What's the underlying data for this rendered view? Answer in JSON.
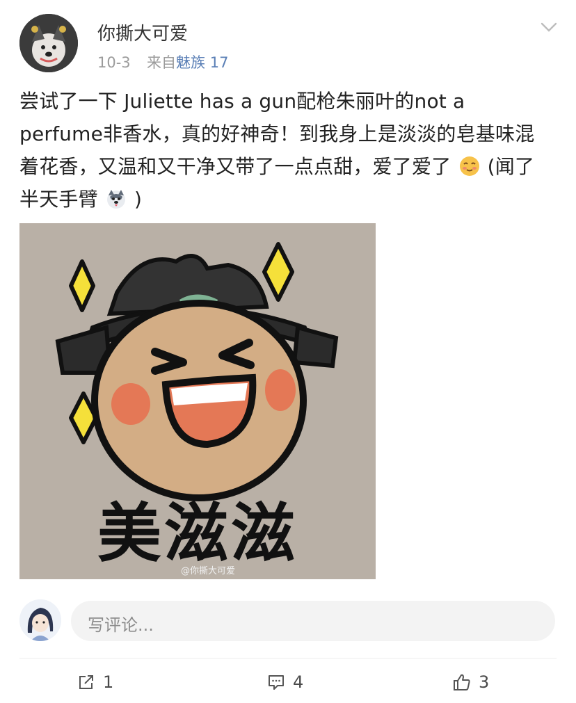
{
  "post": {
    "username": "你撕大可爱",
    "date": "10-3",
    "source_prefix": "来自",
    "source_device": "魅族 17",
    "text_main": "尝试了一下 Juliette has a gun配枪朱丽叶的not a perfume非香水，真的好神奇！到我身上是淡淡的皂基味混着花香，又温和又干净又带了一点点甜，爱了爱了",
    "text_tail": "(闻了半天手臂",
    "text_close": ")",
    "emoji_1": "smiling-blush-emoji",
    "emoji_2": "husky-dog-emoji"
  },
  "sticker": {
    "caption": "美滋滋",
    "watermark": "@你撕大可爱"
  },
  "comment": {
    "placeholder": "写评论..."
  },
  "actions": {
    "repost_count": "1",
    "comment_count": "4",
    "like_count": "3"
  },
  "colors": {
    "link": "#5a7fb6",
    "meta": "#9b9b9b",
    "sticker_bg": "#b9b0a6",
    "sparkle": "#f5e03a"
  }
}
